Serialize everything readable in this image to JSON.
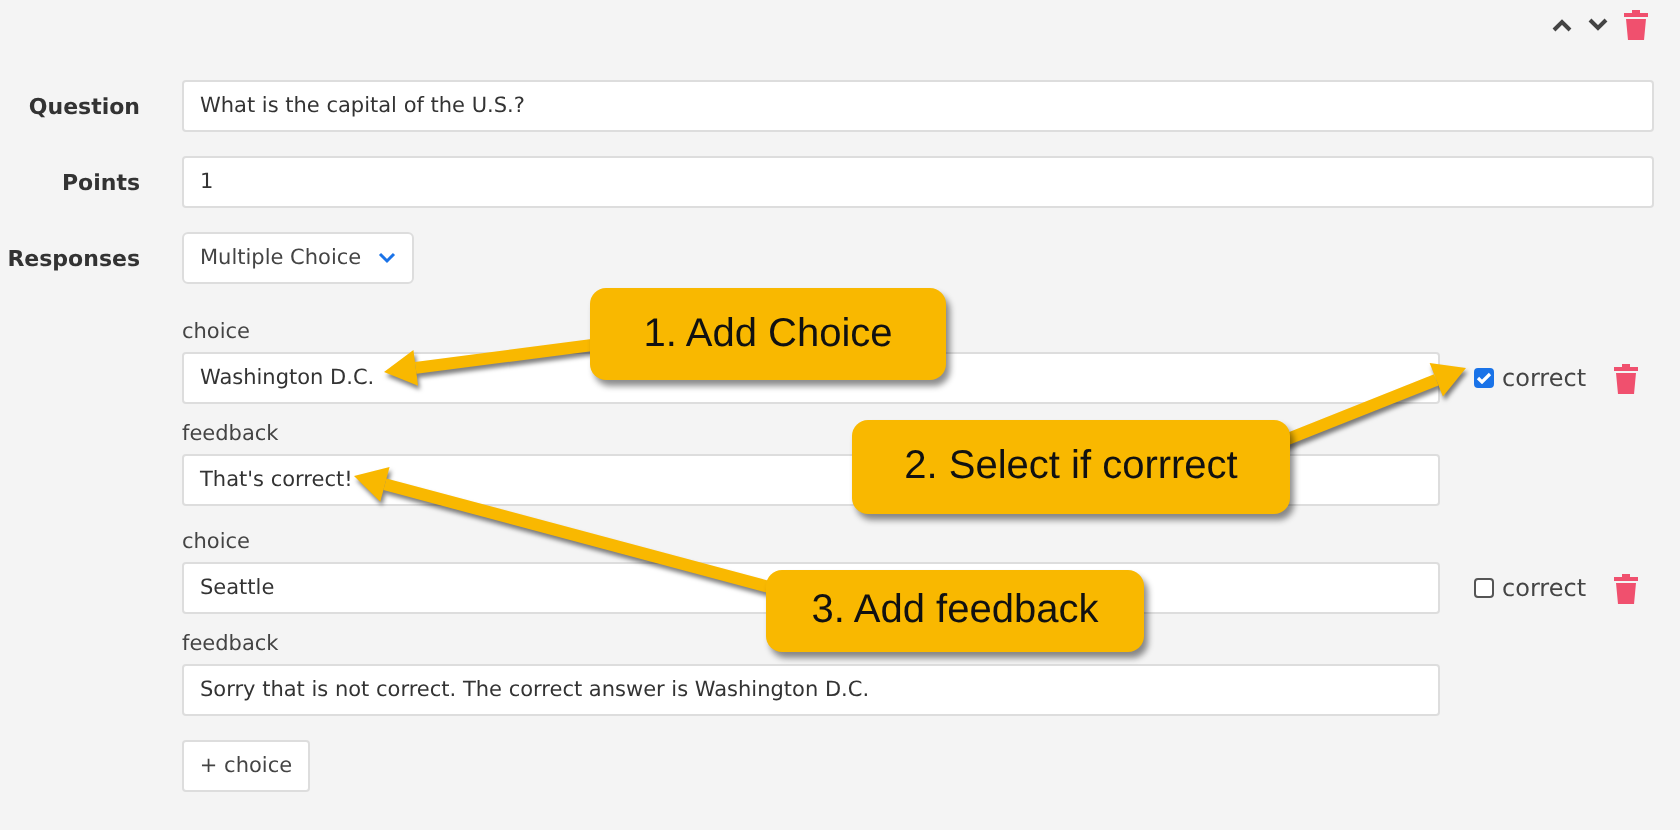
{
  "question": {
    "label": "Question",
    "value": "What is the capital of the U.S.?"
  },
  "points": {
    "label": "Points",
    "value": "1"
  },
  "responses": {
    "label": "Responses",
    "value": "Multiple Choice"
  },
  "choices": [
    {
      "choice_label": "choice",
      "choice": "Washington D.C.",
      "feedback_label": "feedback",
      "feedback": "That's correct!",
      "correct_label": "correct",
      "checked": true
    },
    {
      "choice_label": "choice",
      "choice": "Seattle",
      "feedback_label": "feedback",
      "feedback": "Sorry that is not correct. The correct answer is Washington D.C.",
      "correct_label": "correct",
      "checked": false
    }
  ],
  "add_choice": "+ choice",
  "callouts": [
    {
      "text": "1. Add Choice"
    },
    {
      "text": "2. Select if corrrect"
    },
    {
      "text": "3. Add feedback"
    }
  ]
}
